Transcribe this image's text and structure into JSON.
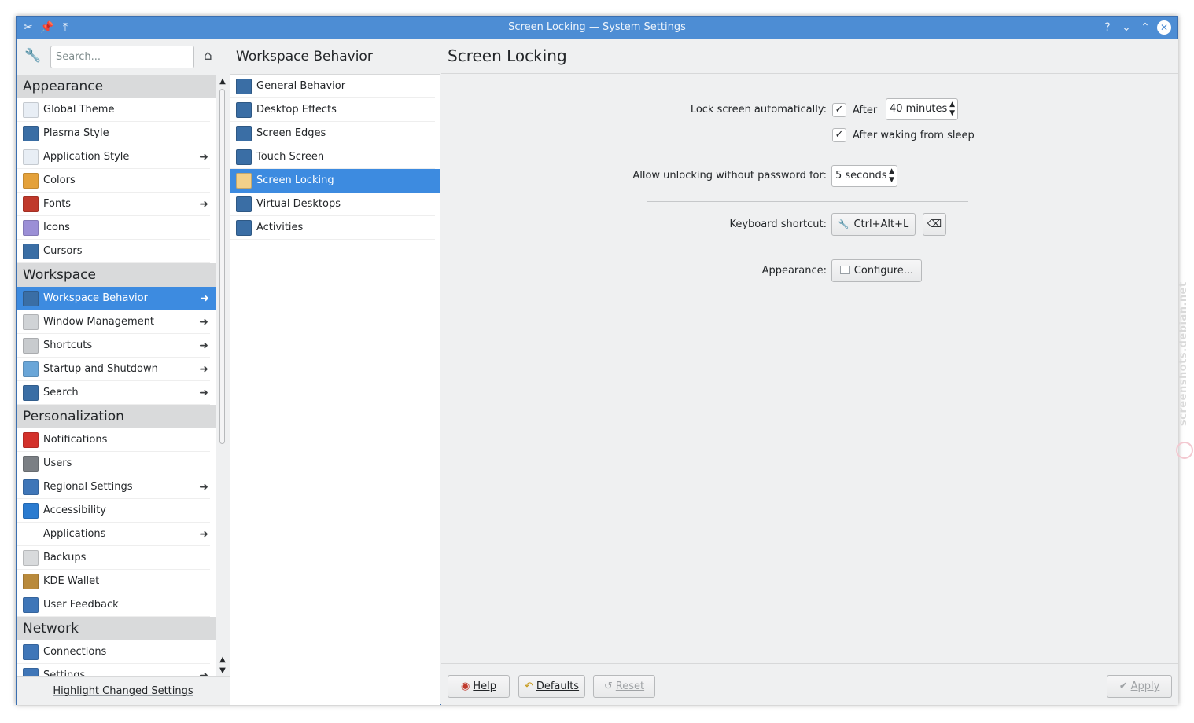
{
  "window": {
    "title": "Screen Locking — System Settings"
  },
  "sidebar": {
    "search_placeholder": "Search...",
    "highlight_label": "Highlight Changed Settings",
    "sections": [
      {
        "header": "Appearance",
        "items": [
          {
            "label": "Global Theme",
            "icon": "global-theme-icon",
            "arrow": false,
            "color": "#e8eef5"
          },
          {
            "label": "Plasma Style",
            "icon": "plasma-style-icon",
            "arrow": false,
            "color": "#3a6ea5"
          },
          {
            "label": "Application Style",
            "icon": "application-style-icon",
            "arrow": true,
            "color": "#e8eef5"
          },
          {
            "label": "Colors",
            "icon": "colors-icon",
            "arrow": false,
            "color": "#e4a13a"
          },
          {
            "label": "Fonts",
            "icon": "fonts-icon",
            "arrow": true,
            "color": "#c0392b"
          },
          {
            "label": "Icons",
            "icon": "icons-icon",
            "arrow": false,
            "color": "#9b8fd6"
          },
          {
            "label": "Cursors",
            "icon": "cursors-icon",
            "arrow": false,
            "color": "#3a6ea5"
          }
        ]
      },
      {
        "header": "Workspace",
        "items": [
          {
            "label": "Workspace Behavior",
            "icon": "workspace-behavior-icon",
            "arrow": true,
            "selected": true,
            "color": "#3a6ea5"
          },
          {
            "label": "Window Management",
            "icon": "window-management-icon",
            "arrow": true,
            "color": "#d0d3d6"
          },
          {
            "label": "Shortcuts",
            "icon": "shortcuts-icon",
            "arrow": true,
            "color": "#c8cbce"
          },
          {
            "label": "Startup and Shutdown",
            "icon": "startup-shutdown-icon",
            "arrow": true,
            "color": "#6aa6d8"
          },
          {
            "label": "Search",
            "icon": "search-module-icon",
            "arrow": true,
            "color": "#3a6ea5"
          }
        ]
      },
      {
        "header": "Personalization",
        "items": [
          {
            "label": "Notifications",
            "icon": "notifications-icon",
            "arrow": false,
            "color": "#d3312b"
          },
          {
            "label": "Users",
            "icon": "users-icon",
            "arrow": false,
            "color": "#7b7f84"
          },
          {
            "label": "Regional Settings",
            "icon": "regional-settings-icon",
            "arrow": true,
            "color": "#3f76b8"
          },
          {
            "label": "Accessibility",
            "icon": "accessibility-icon",
            "arrow": false,
            "color": "#2a7bd0"
          },
          {
            "label": "Applications",
            "icon": "",
            "arrow": true,
            "color": ""
          },
          {
            "label": "Backups",
            "icon": "backups-icon",
            "arrow": false,
            "color": "#d8dadc"
          },
          {
            "label": "KDE Wallet",
            "icon": "kde-wallet-icon",
            "arrow": false,
            "color": "#b98a3c"
          },
          {
            "label": "User Feedback",
            "icon": "user-feedback-icon",
            "arrow": false,
            "color": "#3f76b8"
          }
        ]
      },
      {
        "header": "Network",
        "items": [
          {
            "label": "Connections",
            "icon": "connections-icon",
            "arrow": false,
            "color": "#3f76b8"
          },
          {
            "label": "Settings",
            "icon": "network-settings-icon",
            "arrow": true,
            "color": "#3f76b8"
          }
        ]
      }
    ]
  },
  "middle": {
    "header": "Workspace Behavior",
    "items": [
      {
        "label": "General Behavior",
        "icon": "general-behavior-icon"
      },
      {
        "label": "Desktop Effects",
        "icon": "desktop-effects-icon"
      },
      {
        "label": "Screen Edges",
        "icon": "screen-edges-icon"
      },
      {
        "label": "Touch Screen",
        "icon": "touch-screen-icon"
      },
      {
        "label": "Screen Locking",
        "icon": "screen-locking-icon",
        "selected": true
      },
      {
        "label": "Virtual Desktops",
        "icon": "virtual-desktops-icon"
      },
      {
        "label": "Activities",
        "icon": "activities-icon"
      }
    ]
  },
  "main": {
    "title": "Screen Locking",
    "lock_auto_label": "Lock screen automatically:",
    "after_label": "After",
    "after_value": "40 minutes",
    "after_waking_label": "After waking from sleep",
    "unlock_label": "Allow unlocking without password for:",
    "unlock_value": "5 seconds",
    "shortcut_label": "Keyboard shortcut:",
    "shortcut_value": "Ctrl+Alt+L",
    "appearance_label": "Appearance:",
    "configure_label": "Configure...",
    "after_checked": true,
    "after_waking_checked": true
  },
  "footer": {
    "help_label": "Help",
    "defaults_label": "Defaults",
    "reset_label": "Reset",
    "apply_label": "Apply"
  },
  "watermark": "screenshots.debian.net"
}
